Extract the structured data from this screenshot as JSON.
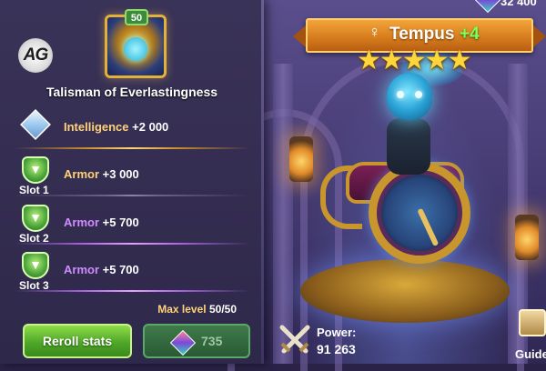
{
  "resources": {
    "gems_value": "32 400"
  },
  "item": {
    "level": "50",
    "title": "Talisman of Everlastingness",
    "main_stat": {
      "name": "Intelligence",
      "value": "+2 000",
      "icon": "crystal-icon"
    },
    "slots": [
      {
        "label": "Slot 1",
        "stat": "Armor",
        "value": "+3 000",
        "name_color": "#ffd27a",
        "icon": "shield-arrow-icon"
      },
      {
        "label": "Slot 2",
        "stat": "Armor",
        "value": "+5 700",
        "name_color": "#d08cff",
        "icon": "shield-arrow-icon"
      },
      {
        "label": "Slot 3",
        "stat": "Armor",
        "value": "+5 700",
        "name_color": "#d08cff",
        "icon": "shield-arrow-icon"
      }
    ],
    "max_level_label": "Max level",
    "max_level_value": "50/50"
  },
  "actions": {
    "reroll_label": "Reroll stats",
    "cost_value": "735"
  },
  "logo": {
    "text": "AG"
  },
  "hero": {
    "gender_symbol": "♀",
    "name": "Tempus",
    "plus": "+4",
    "stars": "★★★★★",
    "power_label": "Power:",
    "power_value": "91 263"
  },
  "guide": {
    "label": "Guide"
  },
  "colors": {
    "accent_gold": "#ffd27a",
    "accent_purple": "#d08cff",
    "button_green": "#4fa828",
    "banner_orange": "#d57a1c",
    "plus_green": "#7fff5a"
  }
}
